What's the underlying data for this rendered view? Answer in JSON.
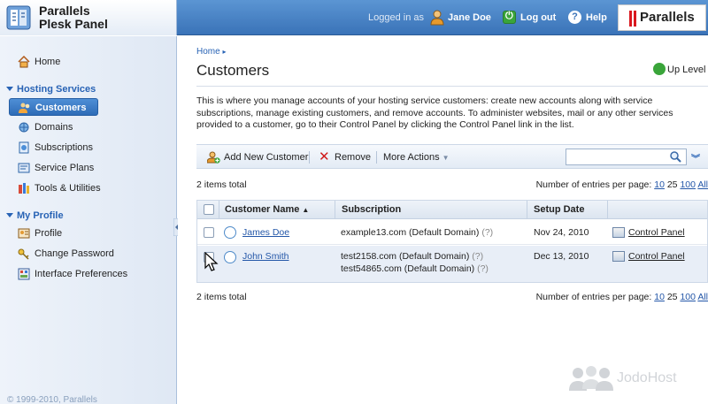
{
  "header": {
    "app_name_line1": "Parallels",
    "app_name_line2": "Plesk Panel",
    "logged_in_label": "Logged in as",
    "user_name": "Jane Doe",
    "logout_label": "Log out",
    "help_label": "Help",
    "brand": "Parallels",
    "brand_color": "#d9181f"
  },
  "sidebar": {
    "items": [
      {
        "label": "Home",
        "icon": "house-icon"
      },
      {
        "label": "Customers",
        "icon": "customers-icon",
        "selected": true
      },
      {
        "label": "Domains",
        "icon": "domains-icon"
      },
      {
        "label": "Subscriptions",
        "icon": "subscriptions-icon"
      },
      {
        "label": "Service Plans",
        "icon": "service-plans-icon"
      },
      {
        "label": "Tools & Utilities",
        "icon": "tools-icon"
      },
      {
        "label": "Profile",
        "icon": "profile-icon"
      },
      {
        "label": "Change Password",
        "icon": "key-icon"
      },
      {
        "label": "Interface Preferences",
        "icon": "preferences-icon"
      }
    ],
    "sections": {
      "hosting": "Hosting Services",
      "profile": "My Profile"
    },
    "footer": "© 1999-2010, Parallels"
  },
  "main": {
    "breadcrumb": "Home",
    "title": "Customers",
    "up_level": "Up Level",
    "description": "This is where you manage accounts of your hosting service customers: create new accounts along with service subscriptions, manage existing customers, and remove accounts. To administer websites, mail or any other services provided to a customer, go to their Control Panel by clicking the Control Panel link in the list.",
    "toolbar": {
      "add_label": "Add New Customer",
      "remove_label": "Remove",
      "more_label": "More Actions",
      "search_value": ""
    },
    "total_top": "2 items total",
    "total_bottom": "2 items total",
    "per_page_label": "Number of entries per page:",
    "per_page_options": [
      "10",
      "25",
      "100",
      "All"
    ],
    "per_page_selected": "25",
    "columns": [
      "Customer Name",
      "Subscription",
      "Setup Date"
    ],
    "rows": [
      {
        "name": "James Doe",
        "subscriptions": [
          "example13.com (Default Domain)"
        ],
        "setup_date": "Nov 24, 2010",
        "panel_link": "Control Panel"
      },
      {
        "name": "John Smith",
        "subscriptions": [
          "test2158.com (Default Domain)",
          "test54865.com (Default Domain)"
        ],
        "setup_date": "Dec 13, 2010",
        "panel_link": "Control Panel"
      }
    ],
    "help_marker": "(?)"
  },
  "watermark": "JodoHost"
}
